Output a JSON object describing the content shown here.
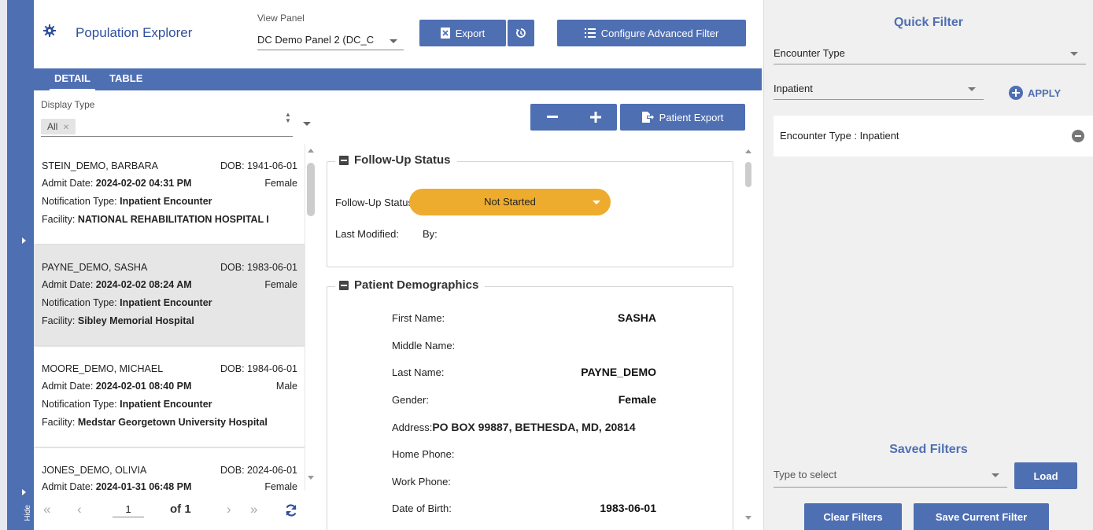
{
  "rail": {
    "hide_label": "Hide"
  },
  "header": {
    "app_title": "Population Explorer",
    "view_panel_label": "View Panel",
    "view_panel_value": "DC Demo Panel 2 (DC_C",
    "export_label": "Export",
    "configure_filter_label": "Configure Advanced Filter"
  },
  "tabs": [
    {
      "label": "DETAIL",
      "active": true
    },
    {
      "label": "TABLE",
      "active": false
    }
  ],
  "display_type": {
    "label": "Display Type",
    "chip": "All",
    "chip_close": "✕"
  },
  "detail_toolbar": {
    "patient_export_label": "Patient Export"
  },
  "patients": [
    {
      "name": "STEIN_DEMO, BARBARA",
      "dob_label": "DOB:",
      "dob": "1941-06-01",
      "admit_label": "Admit Date:",
      "admit": "2024-02-02 04:31 PM",
      "gender": "Female",
      "notif_label": "Notification Type:",
      "notif": "Inpatient Encounter",
      "facility_label": "Facility:",
      "facility": "NATIONAL REHABILITATION HOSPITAL I",
      "selected": false
    },
    {
      "name": "PAYNE_DEMO, SASHA",
      "dob_label": "DOB:",
      "dob": "1983-06-01",
      "admit_label": "Admit Date:",
      "admit": "2024-02-02 08:24 AM",
      "gender": "Female",
      "notif_label": "Notification Type:",
      "notif": "Inpatient Encounter",
      "facility_label": "Facility:",
      "facility": "Sibley Memorial Hospital",
      "selected": true
    },
    {
      "name": "MOORE_DEMO, MICHAEL",
      "dob_label": "DOB:",
      "dob": "1984-06-01",
      "admit_label": "Admit Date:",
      "admit": "2024-02-01 08:40 PM",
      "gender": "Male",
      "notif_label": "Notification Type:",
      "notif": "Inpatient Encounter",
      "facility_label": "Facility:",
      "facility": "Medstar Georgetown University Hospital",
      "selected": false
    },
    {
      "name": "JONES_DEMO, OLIVIA",
      "dob_label": "DOB:",
      "dob": "2024-06-01",
      "admit_label": "Admit Date:",
      "admit": "2024-01-31 06:48 PM",
      "gender": "Female",
      "notif_label": "",
      "notif": "",
      "facility_label": "",
      "facility": "",
      "selected": false
    }
  ],
  "pager": {
    "first": "«",
    "prev": "‹",
    "page": "1",
    "of_label": "of 1",
    "next": "›",
    "last": "»"
  },
  "follow_up": {
    "title": "Follow-Up Status",
    "status_label": "Follow-Up Status:",
    "status_value": "Not Started",
    "last_modified_label": "Last Modified:",
    "by_label": "By:"
  },
  "demographics": {
    "title": "Patient Demographics",
    "rows": [
      {
        "label": "First Name:",
        "value": "SASHA"
      },
      {
        "label": "Middle Name:",
        "value": ""
      },
      {
        "label": "Last Name:",
        "value": "PAYNE_DEMO"
      },
      {
        "label": "Gender:",
        "value": "Female"
      }
    ],
    "address_label": "Address:",
    "address_value": "PO BOX 99887, BETHESDA, MD, 20814",
    "rows2": [
      {
        "label": "Home Phone:",
        "value": ""
      },
      {
        "label": "Work Phone:",
        "value": ""
      },
      {
        "label": "Date of Birth:",
        "value": "1983-06-01"
      }
    ]
  },
  "quick_filter": {
    "title": "Quick Filter",
    "field_value": "Encounter Type",
    "option_value": "Inpatient",
    "apply_label": "APPLY",
    "active_filter": "Encounter Type : Inpatient"
  },
  "saved_filters": {
    "title": "Saved Filters",
    "placeholder": "Type to select",
    "load_label": "Load",
    "clear_label": "Clear Filters",
    "save_label": "Save Current Filter"
  },
  "colors": {
    "accent": "#4f6fb3",
    "status": "#eeac2f",
    "selected_row": "#e6e6e6"
  }
}
